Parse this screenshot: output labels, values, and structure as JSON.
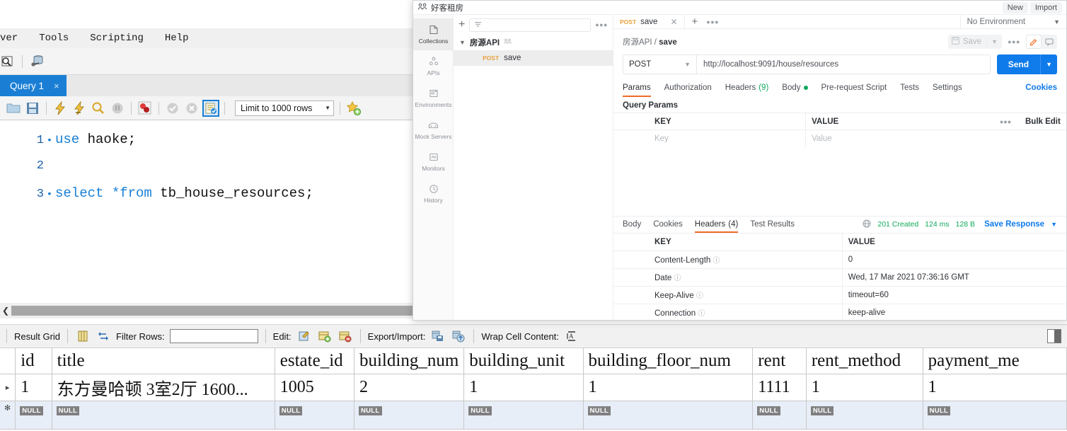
{
  "mysql": {
    "menu_items": [
      "ver",
      "Tools",
      "Scripting",
      "Help"
    ],
    "tab_label": "Query 1",
    "tab_close": "×",
    "limit_label": "Limit to 1000 rows",
    "editor_lines": [
      {
        "num": "1",
        "marker": "•",
        "kw": "use",
        "rest": " haoke;"
      },
      {
        "num": "2",
        "marker": "",
        "kw": "",
        "rest": ""
      },
      {
        "num": "3",
        "marker": "•",
        "kw": "select *from",
        "rest": " tb_house_resources;"
      }
    ],
    "gridbar": {
      "result_grid": "Result Grid",
      "filter_rows": "Filter Rows:",
      "filter_value": "",
      "edit": "Edit:",
      "export_import": "Export/Import:",
      "wrap_cell": "Wrap Cell Content:"
    },
    "grid": {
      "columns": [
        "id",
        "title",
        "estate_id",
        "building_num",
        "building_unit",
        "building_floor_num",
        "rent",
        "rent_method",
        "payment_me"
      ],
      "rows": [
        [
          "1",
          "东方曼哈顿 3室2厅 1600...",
          "1005",
          "2",
          "1",
          "1",
          "1111",
          "1",
          "1"
        ]
      ],
      "new_row_null": "NULL",
      "row_marker": "▸",
      "new_row_marker": "✻"
    }
  },
  "postman": {
    "workspace": "好客租房",
    "top_buttons": [
      "New",
      "Import"
    ],
    "rail": [
      {
        "label": "Collections",
        "icon": "collections-icon",
        "active": true
      },
      {
        "label": "APIs",
        "icon": "apis-icon",
        "active": false
      },
      {
        "label": "Environments",
        "icon": "environments-icon",
        "active": false
      },
      {
        "label": "Mock Servers",
        "icon": "mock-servers-icon",
        "active": false
      },
      {
        "label": "Monitors",
        "icon": "monitors-icon",
        "active": false
      },
      {
        "label": "History",
        "icon": "history-icon",
        "active": false
      }
    ],
    "sidebar": {
      "filter_placeholder": "",
      "collection_name": "房源API",
      "request_method": "POST",
      "request_name": "save"
    },
    "tab": {
      "method": "POST",
      "name": "save"
    },
    "environment": "No Environment",
    "breadcrumb_collection": "房源API",
    "breadcrumb_sep": "/",
    "breadcrumb_request": "save",
    "save_label": "Save",
    "request": {
      "method": "POST",
      "url": "http://localhost:9091/house/resources",
      "send_label": "Send",
      "tabs": [
        {
          "label": "Params",
          "active": true
        },
        {
          "label": "Authorization",
          "active": false
        },
        {
          "label": "Headers",
          "count": "(9)",
          "active": false
        },
        {
          "label": "Body",
          "dot": true,
          "active": false
        },
        {
          "label": "Pre-request Script",
          "active": false
        },
        {
          "label": "Tests",
          "active": false
        },
        {
          "label": "Settings",
          "active": false
        }
      ],
      "cookies_link": "Cookies",
      "query_params_title": "Query Params",
      "param_key_header": "KEY",
      "param_value_header": "VALUE",
      "bulk_edit": "Bulk Edit",
      "key_placeholder": "Key",
      "value_placeholder": "Value"
    },
    "response": {
      "tabs": [
        {
          "label": "Body",
          "active": false
        },
        {
          "label": "Cookies",
          "active": false
        },
        {
          "label": "Headers",
          "count": "(4)",
          "active": true
        },
        {
          "label": "Test Results",
          "active": false
        }
      ],
      "status": "201 Created",
      "time": "124 ms",
      "size": "128 B",
      "save_response": "Save Response",
      "key_header": "KEY",
      "value_header": "VALUE",
      "headers": [
        {
          "key": "Content-Length",
          "value": "0"
        },
        {
          "key": "Date",
          "value": "Wed, 17 Mar 2021 07:36:16 GMT"
        },
        {
          "key": "Keep-Alive",
          "value": "timeout=60"
        },
        {
          "key": "Connection",
          "value": "keep-alive"
        }
      ]
    }
  },
  "colors": {
    "accent_orange": "#ef6c24",
    "send_blue": "#0f7bea",
    "status_green": "#0fa95b",
    "method_post": "#e8a23d",
    "mysql_tab_blue": "#1a7fd4"
  }
}
